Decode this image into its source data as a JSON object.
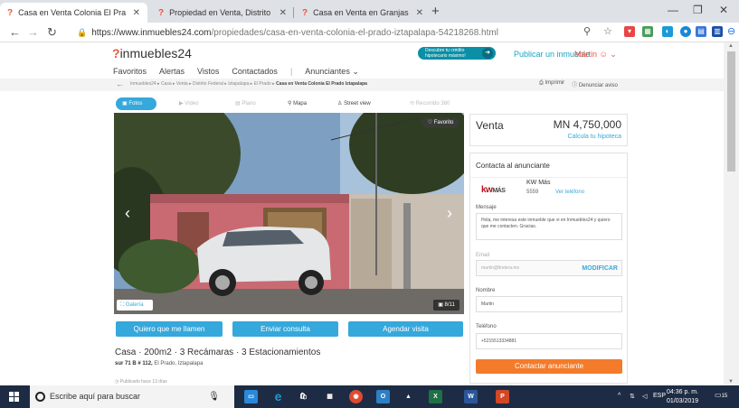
{
  "browser": {
    "tabs": [
      {
        "label": "Casa en Venta Colonia El Prado I",
        "active": true
      },
      {
        "label": "Propiedad en Venta, Distrito Fed",
        "active": false
      },
      {
        "label": "Casa en Venta en Granjas San A",
        "active": false
      }
    ],
    "url_host": "https://www.inmuebles24.com",
    "url_path": "/propiedades/casa-en-venta-colonia-el-prado-iztapalapa-54218268.html"
  },
  "site": {
    "logo_text": "inmuebles24",
    "nav": [
      "Favoritos",
      "Alertas",
      "Vistos",
      "Contactados",
      "Anunciantes"
    ],
    "promo_line1": "Descubre tu crédito",
    "promo_line2": "hipotecario máximo!",
    "publish": "Publicar un inmueble",
    "user": "Martin"
  },
  "breadcrumb": {
    "items": [
      "Inmuebles24",
      "Casa",
      "Venta",
      "Distrito Federal",
      "Iztapalapa",
      "El Prado"
    ],
    "current": "Casa en Venta Colonia El Prado Iztapalapa",
    "print": "Imprimir",
    "report": "Denunciar aviso"
  },
  "media_tabs": [
    "Fotos",
    "Video",
    "Plano",
    "Mapa",
    "Street view",
    "Recorrido 360"
  ],
  "photo": {
    "favorite": "Favorito",
    "gallery": "Galería",
    "counter": "8/11"
  },
  "cta": [
    "Quiero que me llamen",
    "Enviar consulta",
    "Agendar visita"
  ],
  "listing": {
    "title": "Casa · 200m2 · 3 Recámaras · 3 Estacionamientos",
    "street": "sur 71 B # 112,",
    "area": "El Prado, Iztapalapa",
    "published": "Publicado hace 13 días"
  },
  "price": {
    "operation": "Venta",
    "amount": "MN 4,750,000",
    "mortgage": "Calcula tu hipoteca"
  },
  "contact": {
    "heading": "Contacta al anunciante",
    "agent_logo": "kw",
    "agent_logo_suffix": "MÁS",
    "agent_name": "KW Más",
    "agent_phone": "5559",
    "show_phone": "Ver teléfono",
    "message_label": "Mensaje",
    "message": "Hola, me interesa este inmueble que vi en Inmuebles24 y quiero que me contacten. Gracias.",
    "email_label": "Email",
    "email_value": "martin@lindera.mx",
    "modify": "MODIFICAR",
    "name_label": "Nombre",
    "name_value": "Martin",
    "phone_label": "Teléfono",
    "phone_value": "+5215513334881",
    "submit": "Contactar anunciante"
  },
  "taskbar": {
    "search": "Escribe aquí para buscar",
    "lang": "ESP",
    "time": "04:36 p. m.",
    "date": "01/03/2019",
    "notifications": "15"
  },
  "colors": {
    "accent": "#35a8dc",
    "brand": "#e8563f",
    "submit": "#f37b2a",
    "taskbar": "#1d2c44"
  }
}
